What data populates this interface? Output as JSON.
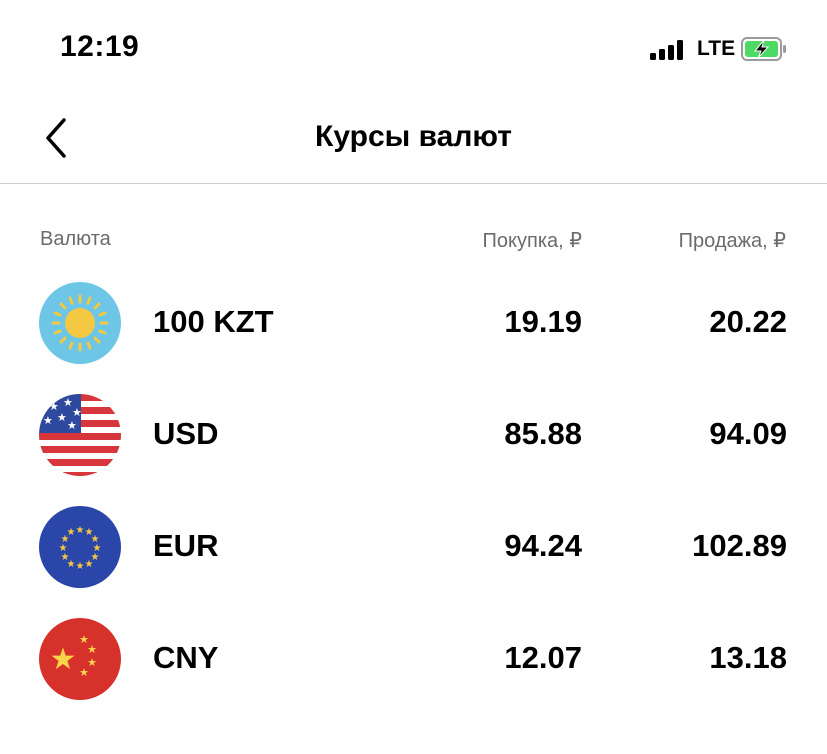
{
  "status_bar": {
    "time": "12:19",
    "network": "LTE"
  },
  "nav": {
    "title": "Курсы валют"
  },
  "table": {
    "headers": {
      "currency": "Валюта",
      "buy": "Покупка, ₽",
      "sell": "Продажа, ₽"
    },
    "rows": [
      {
        "code": "100 KZT",
        "flag_icon": "kazakhstan-flag-icon",
        "buy": "19.19",
        "sell": "20.22"
      },
      {
        "code": "USD",
        "flag_icon": "usa-flag-icon",
        "buy": "85.88",
        "sell": "94.09"
      },
      {
        "code": "EUR",
        "flag_icon": "eu-flag-icon",
        "buy": "94.24",
        "sell": "102.89"
      },
      {
        "code": "CNY",
        "flag_icon": "china-flag-icon",
        "buy": "12.07",
        "sell": "13.18"
      }
    ]
  },
  "colors": {
    "divider": "#cfcfcf",
    "header_text": "#6b6b6b",
    "battery_green": "#4cd964"
  }
}
